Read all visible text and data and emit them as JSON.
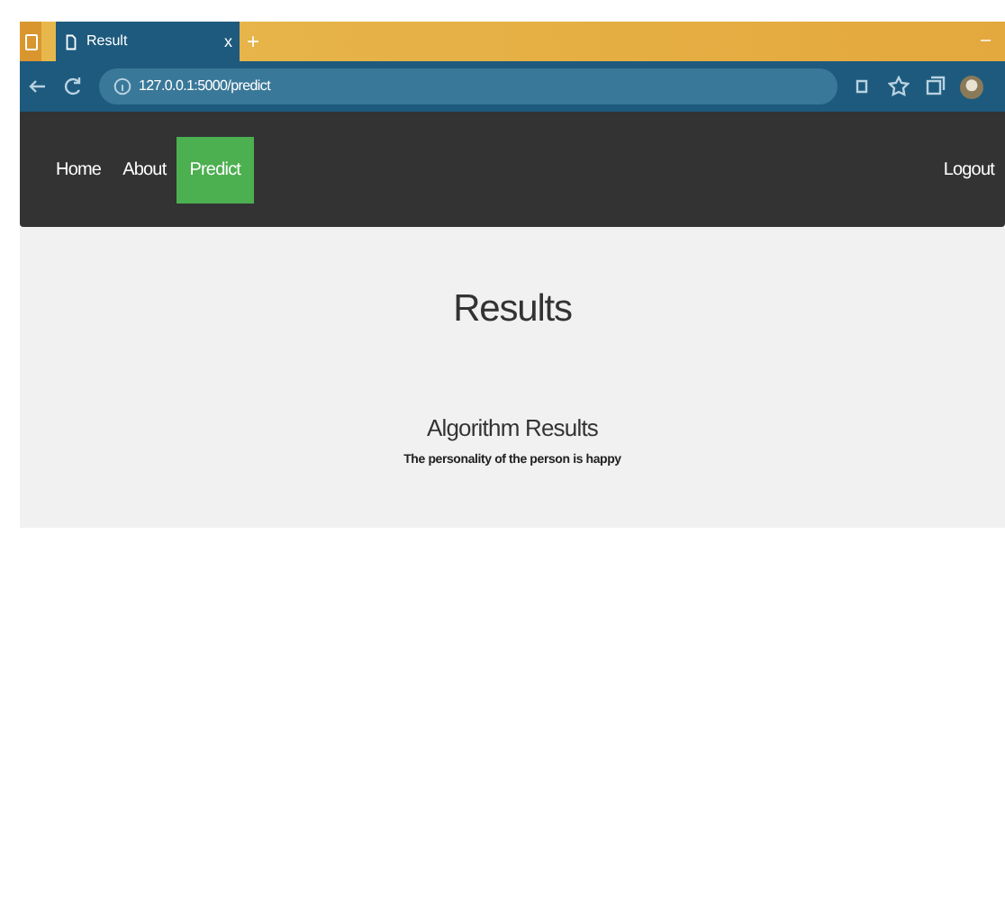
{
  "browser": {
    "tab_title": "Result",
    "tab_close": "x",
    "new_tab": "+",
    "minimize": "–",
    "url": "127.0.0.1:5000/predict"
  },
  "nav": {
    "items": [
      {
        "label": "Home",
        "selected": false
      },
      {
        "label": "About",
        "selected": false
      },
      {
        "label": "Predict",
        "selected": true
      }
    ],
    "logout": "Logout"
  },
  "page": {
    "title": "Results",
    "section_title": "Algorithm Results",
    "result": "The personality of the person is happy"
  }
}
